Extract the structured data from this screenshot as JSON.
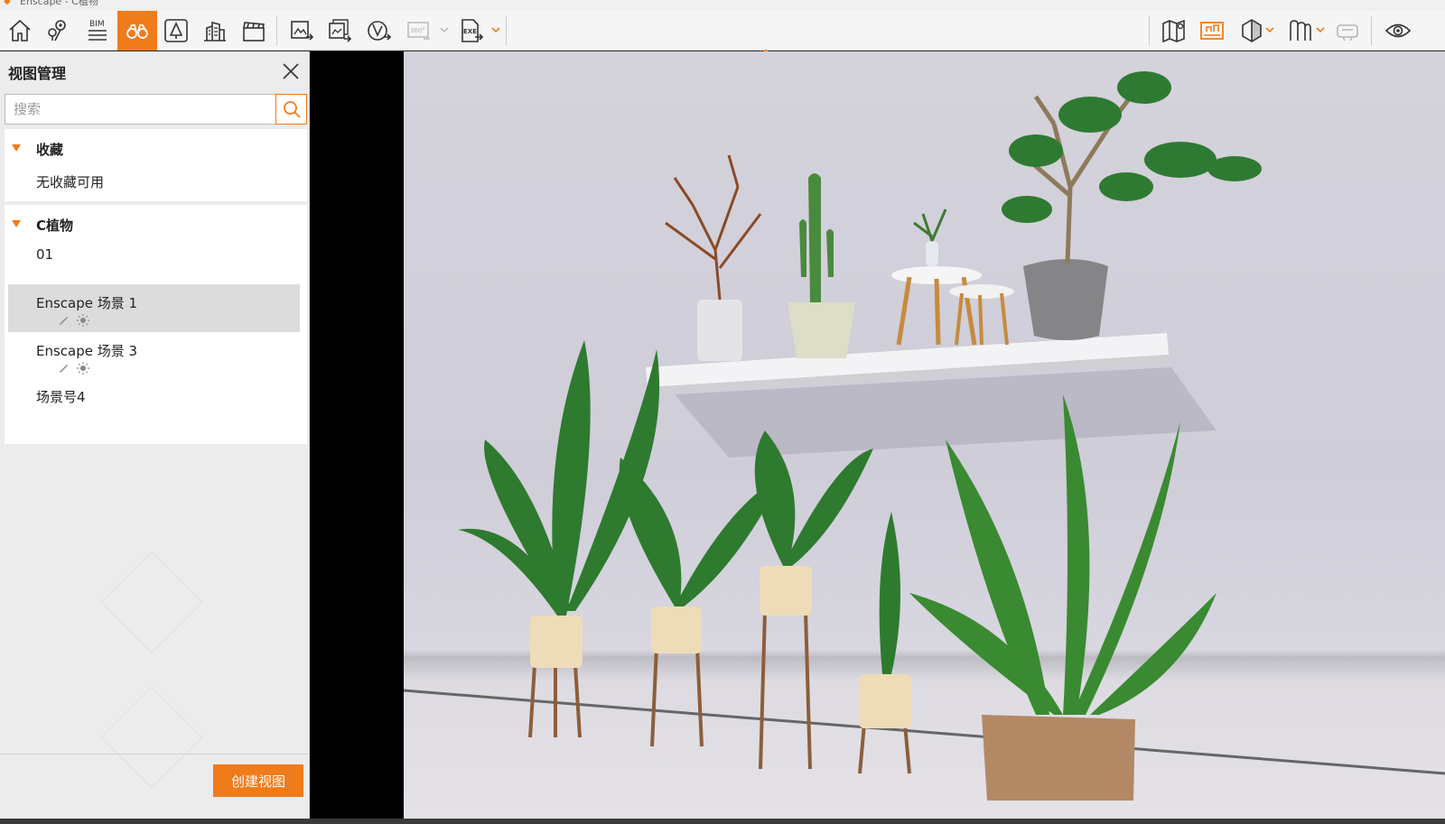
{
  "window": {
    "title": "Enscape - C植物"
  },
  "toolbar": {
    "home": "home-icon",
    "bim_label": "BIM",
    "badge_360": "360°",
    "exe_label": "EXE",
    "accent": "#f07b1a"
  },
  "panel": {
    "title": "视图管理",
    "search_placeholder": "搜索",
    "favorites": {
      "label": "收藏",
      "empty": "无收藏可用"
    },
    "project": {
      "label": "C植物",
      "views": [
        {
          "label": "01"
        },
        {
          "label": "Enscape 场景 1",
          "selected": true
        },
        {
          "label": "Enscape 场景 3"
        },
        {
          "label": "场景号4"
        }
      ]
    },
    "create_button": "创建视图"
  }
}
